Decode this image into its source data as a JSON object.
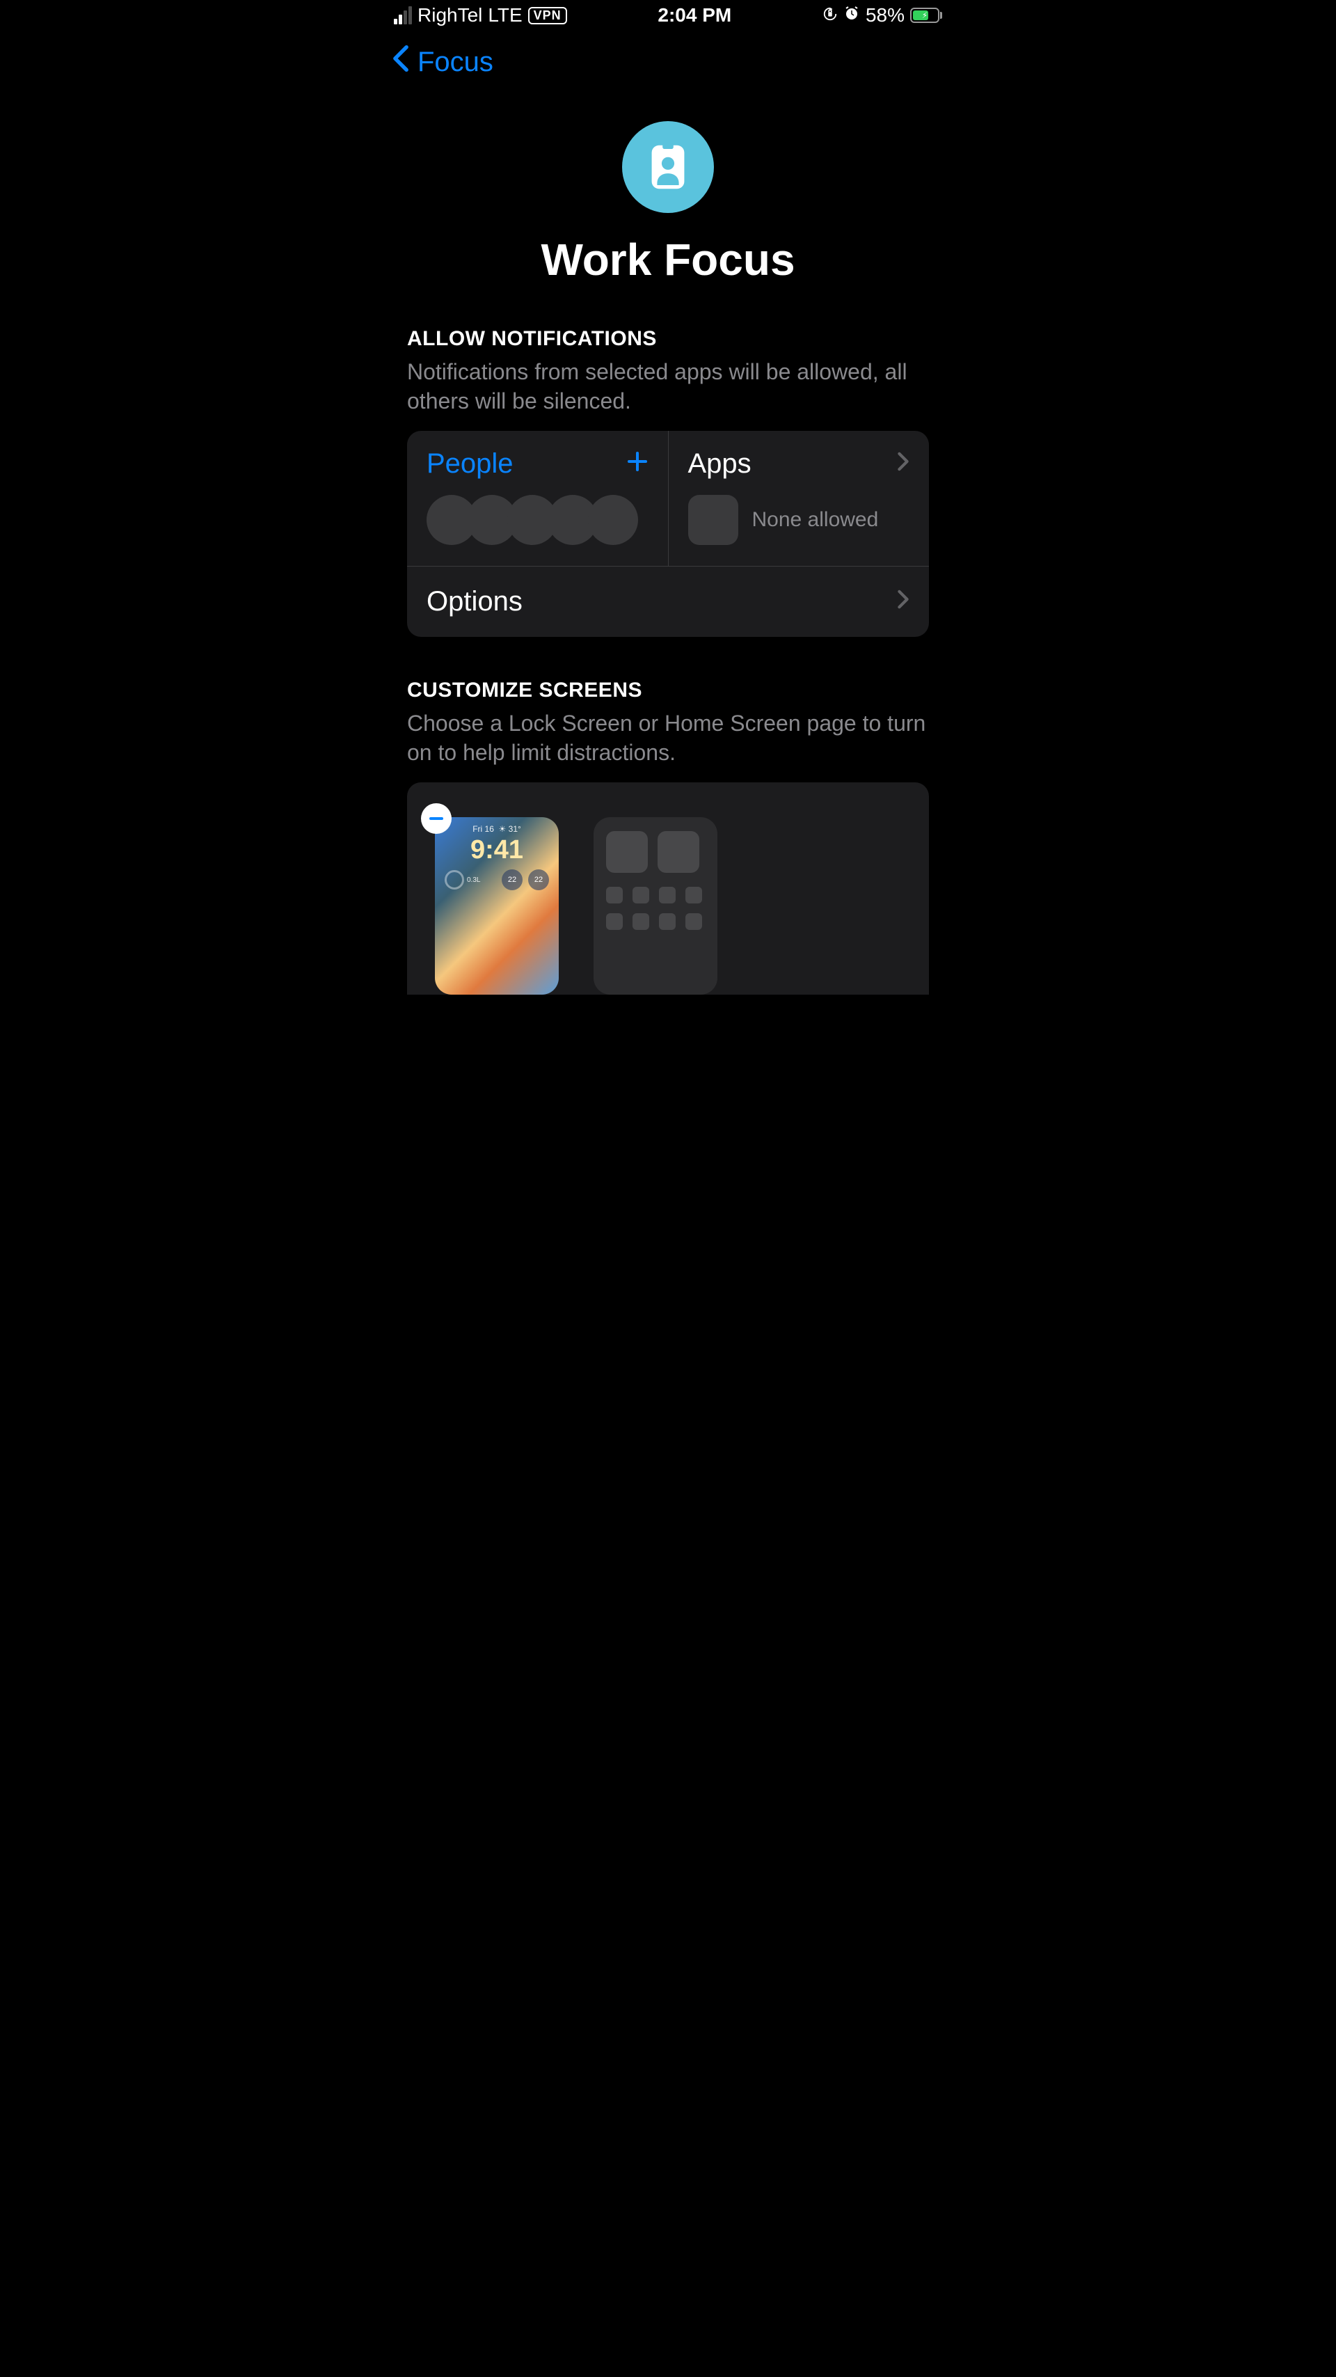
{
  "statusBar": {
    "carrier": "RighTel",
    "network": "LTE",
    "vpn": "VPN",
    "time": "2:04 PM",
    "battery": "58%"
  },
  "nav": {
    "back": "Focus"
  },
  "hero": {
    "title": "Work Focus"
  },
  "allowNotifications": {
    "header": "ALLOW NOTIFICATIONS",
    "desc": "Notifications from selected apps will be allowed, all others will be silenced.",
    "peopleLabel": "People",
    "appsLabel": "Apps",
    "noneAllowed": "None allowed",
    "optionsLabel": "Options"
  },
  "customizeScreens": {
    "header": "CUSTOMIZE SCREENS",
    "desc": "Choose a Lock Screen or Home Screen page to turn on to help limit distractions.",
    "lockScreen": {
      "date": "Fri 16",
      "temp": "31°",
      "time": "9:41",
      "widgetText": "0.3L",
      "pill1": "22",
      "pill2": "22"
    }
  }
}
